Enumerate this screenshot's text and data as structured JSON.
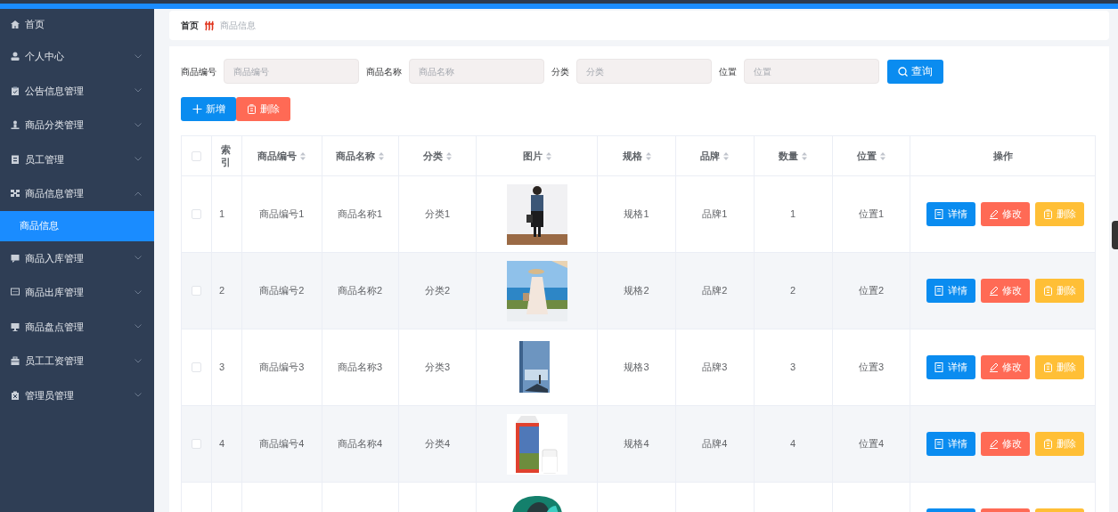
{
  "sidebar": {
    "items": [
      {
        "label": "首页",
        "selected": false
      },
      {
        "label": "个人中心",
        "expanded": false,
        "selected": false
      },
      {
        "label": "公告信息管理",
        "expanded": false,
        "selected": false
      },
      {
        "label": "商品分类管理",
        "expanded": false,
        "selected": false
      },
      {
        "label": "员工管理",
        "expanded": false,
        "selected": false
      },
      {
        "label": "商品信息管理",
        "expanded": true,
        "selected": false,
        "children": [
          {
            "label": "商品信息",
            "selected": true
          }
        ]
      },
      {
        "label": "商品入库管理",
        "expanded": false,
        "selected": false
      },
      {
        "label": "商品出库管理",
        "expanded": false,
        "selected": false
      },
      {
        "label": "商品盘点管理",
        "expanded": false,
        "selected": false
      },
      {
        "label": "员工工资管理",
        "expanded": false,
        "selected": false
      },
      {
        "label": "管理员管理",
        "expanded": false,
        "selected": false
      }
    ]
  },
  "breadcrumb": [
    "首页",
    "商品信息"
  ],
  "filters": [
    {
      "label": "商品编号",
      "placeholder": "商品编号"
    },
    {
      "label": "商品名称",
      "placeholder": "商品名称"
    },
    {
      "label": "分类",
      "placeholder": "分类"
    },
    {
      "label": "位置",
      "placeholder": "位置"
    }
  ],
  "search_button": "查询",
  "toolbar": [
    {
      "kind": "add",
      "label": "新增"
    },
    {
      "kind": "delete",
      "label": "删除"
    }
  ],
  "table": {
    "columns": [
      {
        "label": "索引",
        "sortable": false
      },
      {
        "label": "商品编号",
        "sortable": true
      },
      {
        "label": "商品名称",
        "sortable": true
      },
      {
        "label": "分类",
        "sortable": true
      },
      {
        "label": "图片",
        "sortable": true
      },
      {
        "label": "规格",
        "sortable": true
      },
      {
        "label": "品牌",
        "sortable": true
      },
      {
        "label": "数量",
        "sortable": true
      },
      {
        "label": "位置",
        "sortable": true
      },
      {
        "label": "操作",
        "sortable": false
      }
    ],
    "header_checked": false,
    "rows": [
      {
        "checked": false,
        "cells": [
          "1",
          "商品编号1",
          "商品名称1",
          "分类1",
          null,
          "规格1",
          "品牌1",
          "1",
          "位置1"
        ],
        "actions": [
          {
            "kind": "detail",
            "label": "详情"
          },
          {
            "kind": "edit",
            "label": "修改"
          },
          {
            "kind": "delete",
            "label": "删除"
          }
        ]
      },
      {
        "checked": false,
        "cells": [
          "2",
          "商品编号2",
          "商品名称2",
          "分类2",
          null,
          "规格2",
          "品牌2",
          "2",
          "位置2"
        ],
        "actions": [
          {
            "kind": "detail",
            "label": "详情"
          },
          {
            "kind": "edit",
            "label": "修改"
          },
          {
            "kind": "delete",
            "label": "删除"
          }
        ]
      },
      {
        "checked": false,
        "cells": [
          "3",
          "商品编号3",
          "商品名称3",
          "分类3",
          null,
          "规格3",
          "品牌3",
          "3",
          "位置3"
        ],
        "actions": [
          {
            "kind": "detail",
            "label": "详情"
          },
          {
            "kind": "edit",
            "label": "修改"
          },
          {
            "kind": "delete",
            "label": "删除"
          }
        ]
      },
      {
        "checked": false,
        "cells": [
          "4",
          "商品编号4",
          "商品名称4",
          "分类4",
          null,
          "规格4",
          "品牌4",
          "4",
          "位置4"
        ],
        "actions": [
          {
            "kind": "detail",
            "label": "详情"
          },
          {
            "kind": "edit",
            "label": "修改"
          },
          {
            "kind": "delete",
            "label": "删除"
          }
        ]
      }
    ],
    "partial_row": {
      "actions": [
        {
          "kind": "detail"
        },
        {
          "kind": "edit"
        },
        {
          "kind": "delete"
        }
      ]
    }
  }
}
